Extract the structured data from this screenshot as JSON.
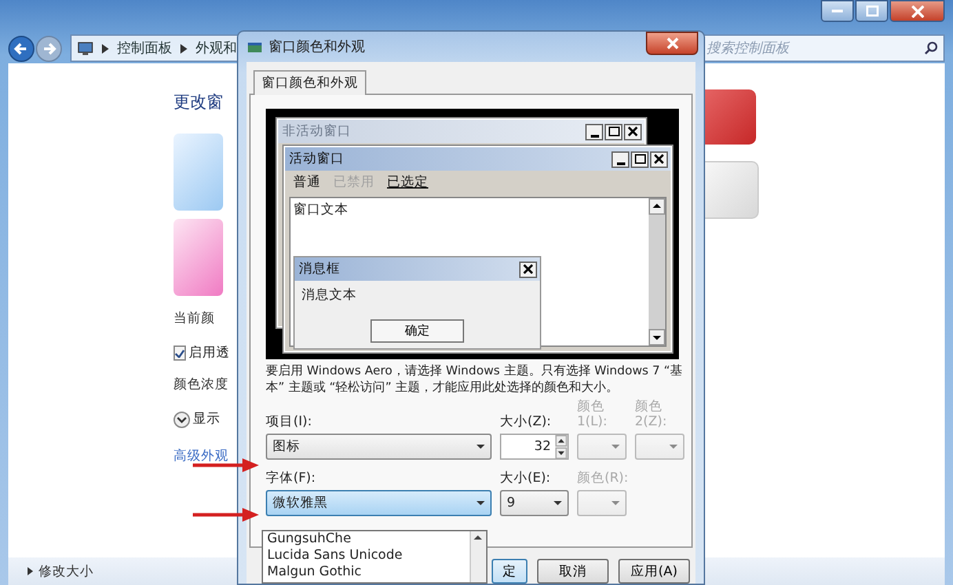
{
  "explorer": {
    "breadcrumb": [
      "控制面板",
      "外观和"
    ],
    "search": {
      "placeholder": "搜索控制面板"
    },
    "heading": "更改窗",
    "current_color_label": "当前颜",
    "transparency": {
      "label": "启用透",
      "checked": true
    },
    "intensity_label": "颜色浓度",
    "details_toggle": {
      "label": "显示",
      "expanded": false
    },
    "advanced_link": "高级外观",
    "status": "修改大小"
  },
  "dialog": {
    "title": "窗口颜色和外观",
    "tabs": [
      {
        "label": "窗口颜色和外观",
        "selected": true
      }
    ],
    "preview": {
      "inactive_window": {
        "title": "非活动窗口"
      },
      "active_window": {
        "title": "活动窗口",
        "menu": [
          {
            "label": "普通",
            "kind": "normal"
          },
          {
            "label": "已禁用",
            "kind": "disabled"
          },
          {
            "label": "已选定",
            "kind": "selected"
          }
        ],
        "text": "窗口文本"
      },
      "message_box": {
        "title": "消息框",
        "text": "消息文本",
        "button": "确定"
      }
    },
    "note": "要启用 Windows Aero，请选择 Windows 主题。只有选择 Windows 7 “基本” 主题或 “轻松访问” 主题，才能应用此处选择的颜色和大小。",
    "item": {
      "label": "项目(I):",
      "value": "图标"
    },
    "item_size": {
      "label": "大小(Z):",
      "value": "32"
    },
    "color1": {
      "label": "颜色 1(L):",
      "disabled": true
    },
    "color2": {
      "label": "颜色 2(Z):",
      "disabled": true
    },
    "font": {
      "label": "字体(F):",
      "value": "微软雅黑",
      "expanded": true,
      "options": [
        "GungsuhChe",
        "Lucida Sans Unicode",
        "Malgun Gothic"
      ]
    },
    "font_size": {
      "label": "大小(E):",
      "value": "9"
    },
    "font_color": {
      "label": "颜色(R):",
      "disabled": true
    },
    "buttons": [
      {
        "label": "定",
        "kind": "default"
      },
      {
        "label": "取消",
        "kind": "normal"
      },
      {
        "label": "应用(A)",
        "kind": "normal"
      }
    ]
  }
}
